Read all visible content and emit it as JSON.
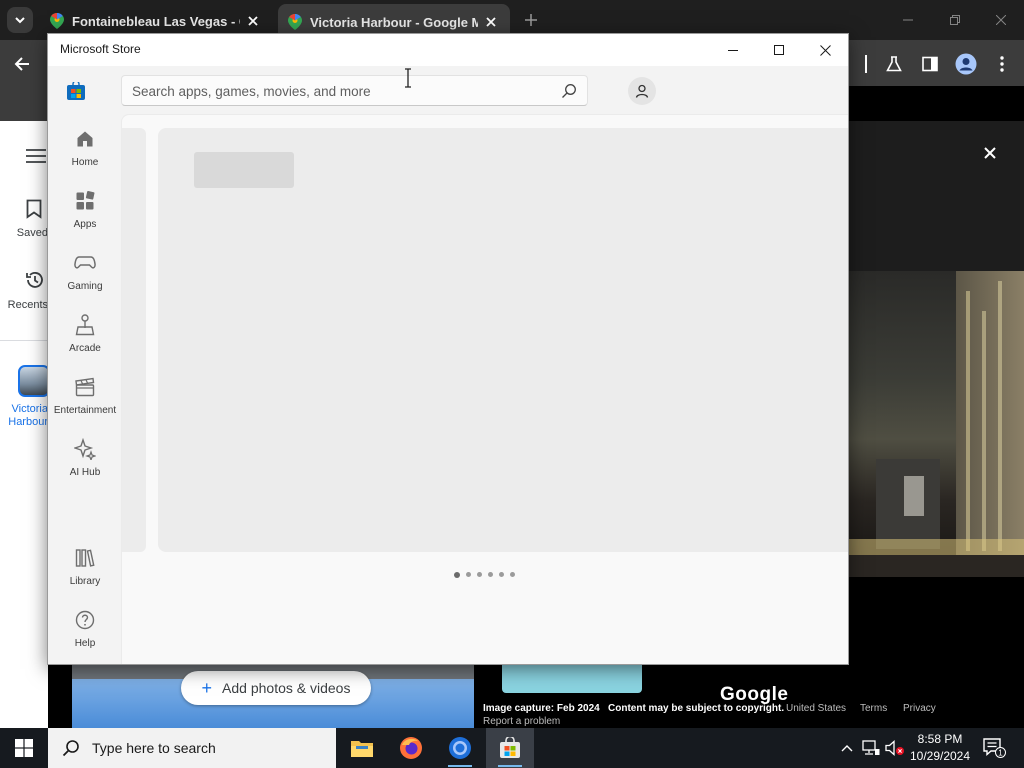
{
  "browser": {
    "tabs": [
      {
        "title": "Fontainebleau Las Vegas - Goo",
        "active": false
      },
      {
        "title": "Victoria Harbour - Google Map",
        "active": true
      }
    ]
  },
  "maps": {
    "sidebar": {
      "saved_label": "Saved",
      "recents_label": "Recents",
      "recent_place_line1": "Victoria",
      "recent_place_line2": "Harbour"
    },
    "add_photos_label": "Add photos & videos",
    "image_capture": "Image capture: Feb 2024",
    "copyright_note": "Content may be subject to copyright.",
    "region": "United States",
    "terms": "Terms",
    "privacy": "Privacy",
    "report": "Report a problem",
    "wordmark": "Google"
  },
  "store": {
    "window_title": "Microsoft Store",
    "search_placeholder": "Search apps, games, movies, and more",
    "nav": [
      {
        "label": "Home",
        "icon": "home-icon"
      },
      {
        "label": "Apps",
        "icon": "apps-icon"
      },
      {
        "label": "Gaming",
        "icon": "gamepad-icon"
      },
      {
        "label": "Arcade",
        "icon": "joystick-icon"
      },
      {
        "label": "Entertainment",
        "icon": "clapperboard-icon"
      },
      {
        "label": "AI Hub",
        "icon": "sparkle-icon"
      },
      {
        "label": "Library",
        "icon": "library-icon"
      },
      {
        "label": "Help",
        "icon": "help-icon"
      }
    ],
    "carousel_pages": 6,
    "carousel_active": 1
  },
  "taskbar": {
    "search_placeholder": "Type here to search",
    "time": "8:58 PM",
    "date": "10/29/2024",
    "notification_count": "1"
  }
}
